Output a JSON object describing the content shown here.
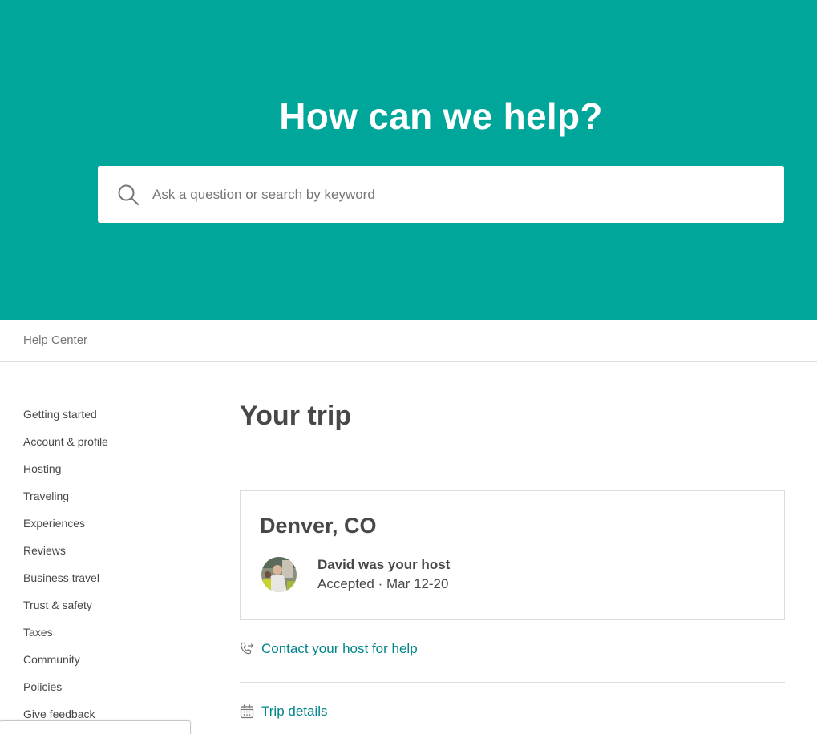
{
  "hero": {
    "title": "How can we help?",
    "background_color": "#00a699"
  },
  "search": {
    "placeholder": "Ask a question or search by keyword",
    "value": "",
    "icon": "search-icon"
  },
  "breadcrumb": {
    "label": "Help Center"
  },
  "sidebar": {
    "items": [
      {
        "label": "Getting started"
      },
      {
        "label": "Account & profile"
      },
      {
        "label": "Hosting"
      },
      {
        "label": "Traveling"
      },
      {
        "label": "Experiences"
      },
      {
        "label": "Reviews"
      },
      {
        "label": "Business travel"
      },
      {
        "label": "Trust & safety"
      },
      {
        "label": "Taxes"
      },
      {
        "label": "Community"
      },
      {
        "label": "Policies"
      },
      {
        "label": "Give feedback"
      }
    ]
  },
  "main": {
    "title": "Your trip",
    "trip": {
      "city": "Denver, CO",
      "host_line": "David was your host",
      "status_line": "Accepted · Mar 12-20"
    },
    "actions": [
      {
        "label": "Contact your host for help",
        "icon": "phone-forward-icon"
      },
      {
        "label": "Trip details",
        "icon": "calendar-icon"
      }
    ]
  },
  "colors": {
    "accent": "#008489",
    "text": "#484848",
    "muted": "#767676",
    "border": "#dcdcdc"
  }
}
